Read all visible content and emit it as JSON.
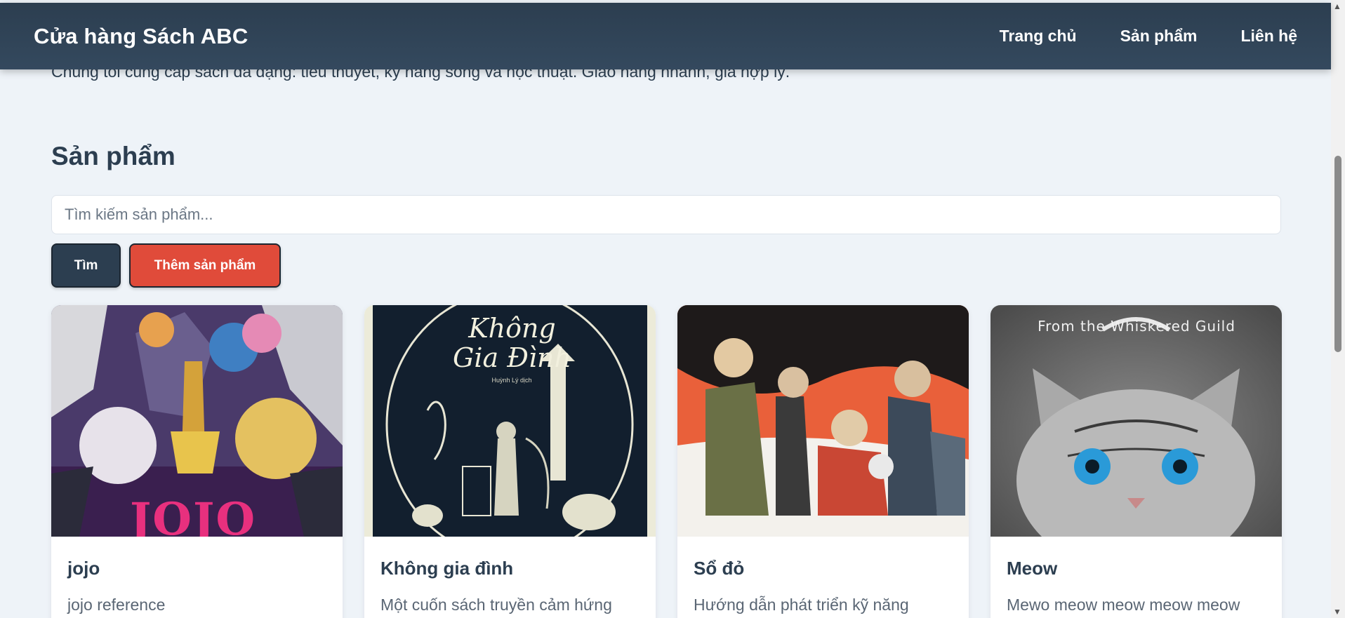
{
  "navbar": {
    "brand": "Cửa hàng Sách ABC",
    "links": [
      "Trang chủ",
      "Sản phẩm",
      "Liên hệ"
    ]
  },
  "intro": "Chúng tôi cung cấp sách đa dạng: tiểu thuyết, kỹ năng sống và học thuật. Giao hàng nhanh, giá hợp lý.",
  "products_section": {
    "title": "Sản phẩm",
    "search_placeholder": "Tìm kiếm sản phẩm...",
    "search_button": "Tìm",
    "add_button": "Thêm sản phẩm"
  },
  "products": [
    {
      "title": "jojo",
      "description": "jojo reference",
      "cover_text": "JOJO"
    },
    {
      "title": "Không gia đình",
      "description": "Một cuốn sách truyền cảm hứng",
      "cover_text": "Không Gia Đình",
      "cover_subtext": "Huỳnh Lý dịch"
    },
    {
      "title": "Sổ đỏ",
      "description": "Hướng dẫn phát triển kỹ năng"
    },
    {
      "title": "Meow",
      "description": "Mewo meow meow meow meow",
      "cover_text": "From the Whiskered Guild"
    }
  ],
  "colors": {
    "navbar": "#2c3e50",
    "accent_red": "#e04b3a",
    "background": "#eef3f8"
  },
  "icons": [
    "scroll-up-arrow-icon",
    "scroll-down-arrow-icon"
  ]
}
